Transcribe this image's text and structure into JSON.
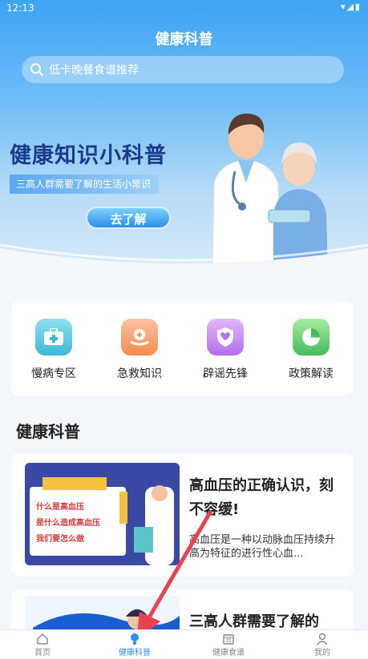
{
  "status": {
    "time": "12:13"
  },
  "header": {
    "title": "健康科普"
  },
  "search": {
    "placeholder": "低卡晚餐食谱推荐"
  },
  "banner": {
    "headline": "健康知识小科普",
    "subtitle": "三高人群需要了解的生活小常识",
    "button": "去了解"
  },
  "categories": [
    {
      "label": "慢病专区",
      "icon": "medical-kit-icon",
      "color": "#3bb8d6"
    },
    {
      "label": "急救知识",
      "icon": "heart-hand-icon",
      "color": "#f38a4d"
    },
    {
      "label": "辟谣先锋",
      "icon": "shield-icon",
      "color": "#b46ee6"
    },
    {
      "label": "政策解读",
      "icon": "pie-chart-icon",
      "color": "#45bb5c"
    }
  ],
  "section": {
    "title": "健康科普"
  },
  "articles": [
    {
      "title": "高血压的正确认识，刻不容缓!",
      "desc": "高血压是一种以动脉血压持续升高为特征的进行性心血...",
      "thumb_lines": [
        "什么是高血压",
        "是什么造成高血压",
        "我们要怎么做"
      ]
    },
    {
      "title": "三高人群需要了解的"
    }
  ],
  "tabbar": [
    {
      "label": "首页",
      "icon": "home-icon"
    },
    {
      "label": "健康科普",
      "icon": "bulb-icon",
      "active": true
    },
    {
      "label": "健康食谱",
      "icon": "calendar-icon"
    },
    {
      "label": "我的",
      "icon": "user-icon"
    }
  ]
}
